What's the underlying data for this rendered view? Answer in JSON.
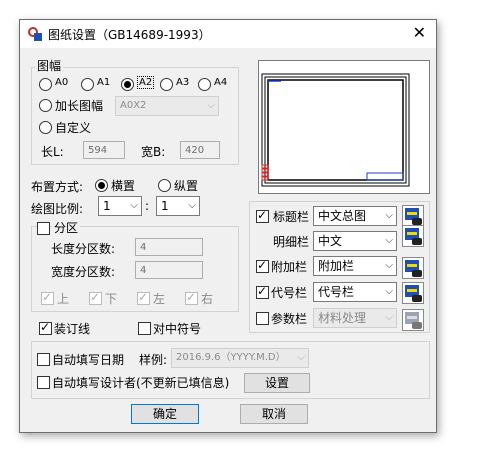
{
  "window": {
    "title": "图纸设置（GB14689-1993）",
    "close_glyph": "✕"
  },
  "sheet_size": {
    "group_label": "图幅",
    "options": [
      {
        "label": "A0",
        "selected": false
      },
      {
        "label": "A1",
        "selected": false
      },
      {
        "label": "A2",
        "selected": true
      },
      {
        "label": "A3",
        "selected": false
      },
      {
        "label": "A4",
        "selected": false
      }
    ],
    "extended_label": "加长图幅",
    "extended_value": "A0X2",
    "custom_label": "自定义",
    "length_label": "长L:",
    "length_value": "594",
    "width_label": "宽B:",
    "width_value": "420"
  },
  "layout": {
    "label": "布置方式:",
    "landscape_label": "横置",
    "portrait_label": "纵置",
    "selected": "landscape"
  },
  "scale": {
    "label": "绘图比例:",
    "left": "1",
    "separator": ":",
    "right": "1"
  },
  "zones": {
    "group_label": "分区",
    "enabled": false,
    "length_label": "长度分区数:",
    "length_value": "4",
    "width_label": "宽度分区数:",
    "width_value": "4",
    "sides": [
      {
        "label": "上",
        "checked": true
      },
      {
        "label": "下",
        "checked": true
      },
      {
        "label": "左",
        "checked": true
      },
      {
        "label": "右",
        "checked": true
      }
    ]
  },
  "binding_edge": {
    "label": "装订线",
    "checked": true
  },
  "center_mark": {
    "label": "对中符号",
    "checked": false
  },
  "blocks": [
    {
      "label": "标题栏",
      "checked": true,
      "value": "中文总图",
      "enabled": true
    },
    {
      "label": "明细栏",
      "checked": null,
      "value": "中文",
      "enabled": true
    },
    {
      "label": "附加栏",
      "checked": true,
      "value": "附加栏",
      "enabled": true
    },
    {
      "label": "代号栏",
      "checked": true,
      "value": "代号栏",
      "enabled": true
    },
    {
      "label": "参数栏",
      "checked": false,
      "value": "材料处理",
      "enabled": false
    }
  ],
  "autofill": {
    "date_label": "自动填写日期",
    "date_checked": false,
    "example_label": "样例:",
    "example_value": "2016.9.6（YYYY.M.D）",
    "designer_label": "自动填写设计者(不更新已填信息)",
    "designer_checked": false,
    "settings_button": "设置"
  },
  "buttons": {
    "ok": "确定",
    "cancel": "取消"
  },
  "colors": {
    "accent_blue": "#1f4fb3",
    "preview_red": "#e02020",
    "preview_blue": "#1a3fc0"
  }
}
